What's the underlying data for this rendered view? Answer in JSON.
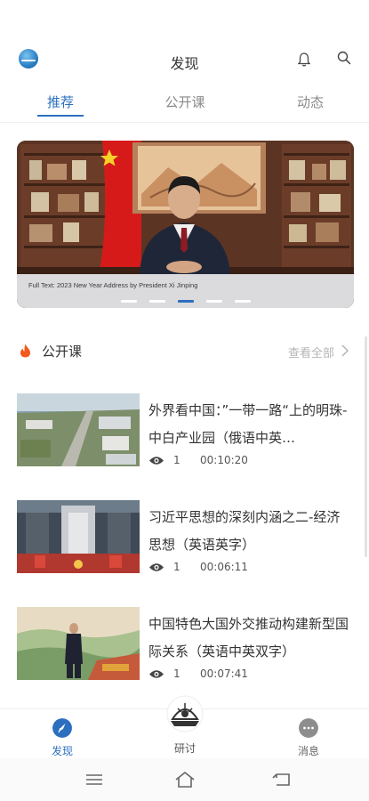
{
  "header": {
    "title": "发现",
    "logo_icon": "globe-logo-icon",
    "bell_icon": "bell-icon",
    "search_icon": "search-icon"
  },
  "tabs": [
    {
      "label": "推荐",
      "active": true
    },
    {
      "label": "公开课",
      "active": false
    },
    {
      "label": "动态",
      "active": false
    }
  ],
  "banner": {
    "caption": "Full Text: 2023 New Year Address by President Xi Jinping",
    "slide_count": 5,
    "active_slide": 3
  },
  "section": {
    "title": "公开课",
    "see_all": "查看全部",
    "icon": "flame-icon"
  },
  "courses": [
    {
      "title": "外界看中国：”一带一路“上的明珠-中白产业园（俄语中英…",
      "views": "1",
      "duration": "00:10:20"
    },
    {
      "title": "习近平思想的深刻内涵之二-经济思想（英语英字）",
      "views": "1",
      "duration": "00:06:11"
    },
    {
      "title": "中国特色大国外交推动构建新型国际关系（英语中英双字）",
      "views": "1",
      "duration": "00:07:41"
    }
  ],
  "bottom_nav": {
    "items": [
      {
        "label": "发现",
        "icon": "compass-icon",
        "active": true
      },
      {
        "label": "研讨",
        "icon": "seminar-emblem-icon",
        "active": false
      },
      {
        "label": "消息",
        "icon": "chat-bubble-icon",
        "active": false
      }
    ]
  },
  "colors": {
    "accent": "#2c6fbf",
    "flame": "#f25a1c",
    "muted": "#8a8a8a"
  }
}
